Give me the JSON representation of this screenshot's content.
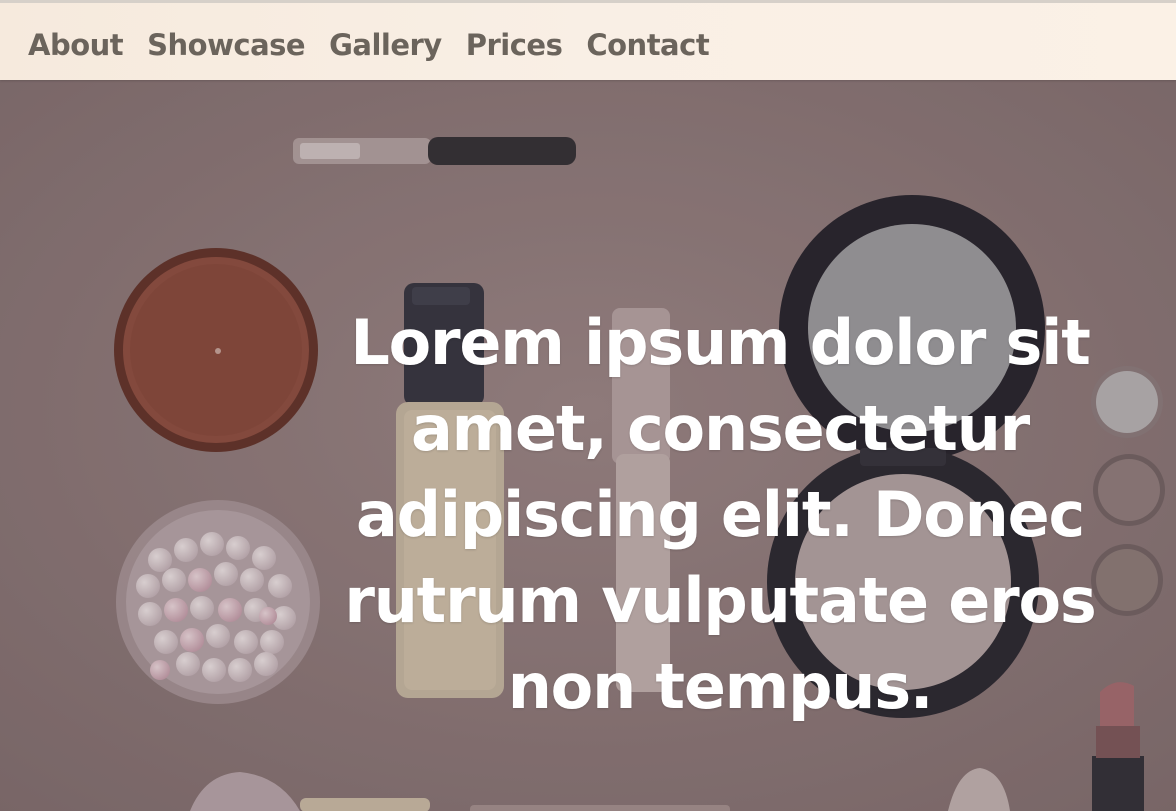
{
  "nav": {
    "items": [
      {
        "label": "About"
      },
      {
        "label": "Showcase"
      },
      {
        "label": "Gallery"
      },
      {
        "label": "Prices"
      },
      {
        "label": "Contact"
      }
    ]
  },
  "hero": {
    "headline": "Lorem ipsum dolor sit amet, consectetur adipiscing elit. Donec rutrum vulputate eros non tempus.",
    "background_image": "cosmetics-flatlay-photo"
  },
  "colors": {
    "nav_background": "#f8ede2",
    "nav_text": "#6b645c",
    "hero_overlay": "#8a7676",
    "hero_text": "#ffffff"
  }
}
